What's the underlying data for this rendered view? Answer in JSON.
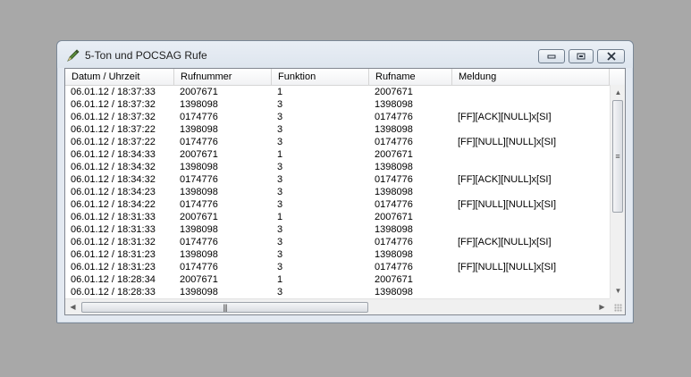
{
  "window": {
    "title": "5-Ton und POCSAG Rufe",
    "icon": "pencil-icon"
  },
  "columns": [
    "Datum / Uhrzeit",
    "Rufnummer",
    "Funktion",
    "Rufname",
    "Meldung"
  ],
  "rows": [
    {
      "datetime": "06.01.12 / 18:37:33",
      "rufnummer": "2007671",
      "funktion": "1",
      "rufname": "2007671",
      "meldung": ""
    },
    {
      "datetime": "06.01.12 / 18:37:32",
      "rufnummer": "1398098",
      "funktion": "3",
      "rufname": "1398098",
      "meldung": ""
    },
    {
      "datetime": "06.01.12 / 18:37:32",
      "rufnummer": "0174776",
      "funktion": "3",
      "rufname": "0174776",
      "meldung": "[FF][ACK][NULL]x[SI]"
    },
    {
      "datetime": "06.01.12 / 18:37:22",
      "rufnummer": "1398098",
      "funktion": "3",
      "rufname": "1398098",
      "meldung": ""
    },
    {
      "datetime": "06.01.12 / 18:37:22",
      "rufnummer": "0174776",
      "funktion": "3",
      "rufname": "0174776",
      "meldung": "[FF][NULL][NULL]x[SI]"
    },
    {
      "datetime": "06.01.12 / 18:34:33",
      "rufnummer": "2007671",
      "funktion": "1",
      "rufname": "2007671",
      "meldung": ""
    },
    {
      "datetime": "06.01.12 / 18:34:32",
      "rufnummer": "1398098",
      "funktion": "3",
      "rufname": "1398098",
      "meldung": ""
    },
    {
      "datetime": "06.01.12 / 18:34:32",
      "rufnummer": "0174776",
      "funktion": "3",
      "rufname": "0174776",
      "meldung": "[FF][ACK][NULL]x[SI]"
    },
    {
      "datetime": "06.01.12 / 18:34:23",
      "rufnummer": "1398098",
      "funktion": "3",
      "rufname": "1398098",
      "meldung": ""
    },
    {
      "datetime": "06.01.12 / 18:34:22",
      "rufnummer": "0174776",
      "funktion": "3",
      "rufname": "0174776",
      "meldung": "[FF][NULL][NULL]x[SI]"
    },
    {
      "datetime": "06.01.12 / 18:31:33",
      "rufnummer": "2007671",
      "funktion": "1",
      "rufname": "2007671",
      "meldung": ""
    },
    {
      "datetime": "06.01.12 / 18:31:33",
      "rufnummer": "1398098",
      "funktion": "3",
      "rufname": "1398098",
      "meldung": ""
    },
    {
      "datetime": "06.01.12 / 18:31:32",
      "rufnummer": "0174776",
      "funktion": "3",
      "rufname": "0174776",
      "meldung": "[FF][ACK][NULL]x[SI]"
    },
    {
      "datetime": "06.01.12 / 18:31:23",
      "rufnummer": "1398098",
      "funktion": "3",
      "rufname": "1398098",
      "meldung": ""
    },
    {
      "datetime": "06.01.12 / 18:31:23",
      "rufnummer": "0174776",
      "funktion": "3",
      "rufname": "0174776",
      "meldung": "[FF][NULL][NULL]x[SI]"
    },
    {
      "datetime": "06.01.12 / 18:28:34",
      "rufnummer": "2007671",
      "funktion": "1",
      "rufname": "2007671",
      "meldung": ""
    },
    {
      "datetime": "06.01.12 / 18:28:33",
      "rufnummer": "1398098",
      "funktion": "3",
      "rufname": "1398098",
      "meldung": ""
    }
  ],
  "colors": {
    "desktop": "#a8a8a8",
    "window_frame": "#e3e9f1",
    "list_background": "#ffffff"
  }
}
